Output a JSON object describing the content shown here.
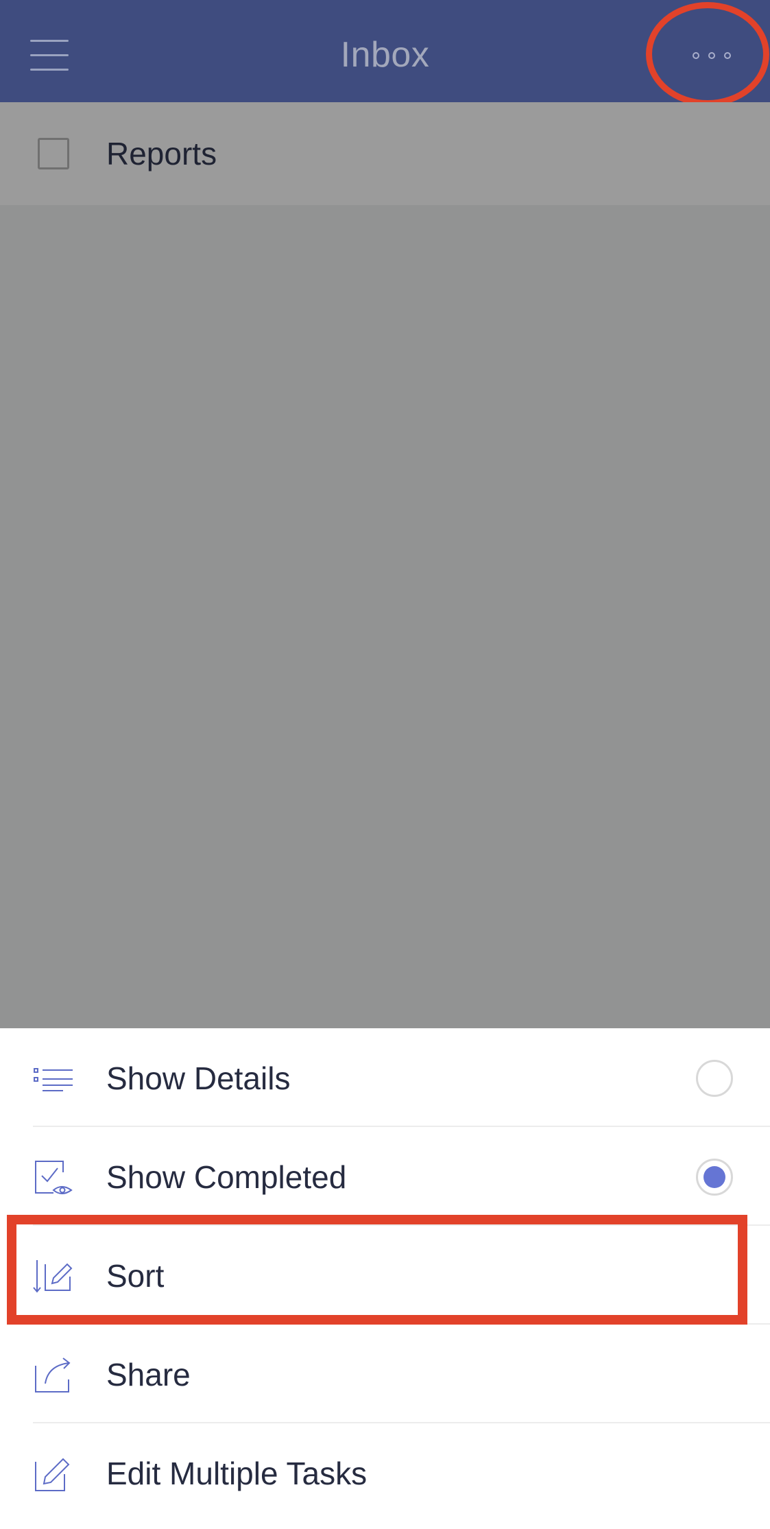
{
  "header": {
    "title": "Inbox",
    "background": "#3f4c7f",
    "menu_icon": "hamburger-icon",
    "more_icon": "ellipsis-icon"
  },
  "tasks": [
    {
      "label": "Reports",
      "checked": false
    }
  ],
  "menu": {
    "items": [
      {
        "label": "Show Details",
        "icon": "details-list-icon",
        "toggle": "off"
      },
      {
        "label": "Show Completed",
        "icon": "completed-eye-icon",
        "toggle": "on"
      },
      {
        "label": "Sort",
        "icon": "sort-icon"
      },
      {
        "label": "Share",
        "icon": "share-icon"
      },
      {
        "label": "Edit Multiple Tasks",
        "icon": "edit-icon"
      }
    ],
    "accent": "#6575d4"
  },
  "annotation_color": "#e2422a"
}
